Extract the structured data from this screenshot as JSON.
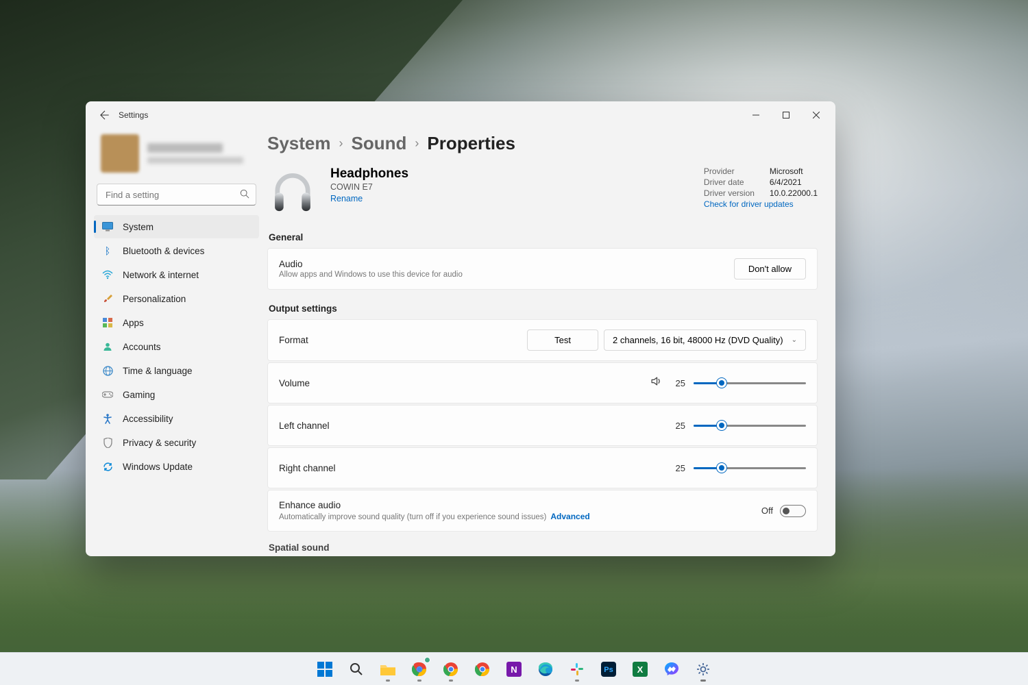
{
  "window": {
    "back_tooltip": "Back",
    "title": "Settings"
  },
  "search": {
    "placeholder": "Find a setting"
  },
  "sidebar": {
    "items": [
      {
        "label": "System",
        "icon": "display"
      },
      {
        "label": "Bluetooth & devices",
        "icon": "bluetooth"
      },
      {
        "label": "Network & internet",
        "icon": "wifi"
      },
      {
        "label": "Personalization",
        "icon": "brush"
      },
      {
        "label": "Apps",
        "icon": "apps"
      },
      {
        "label": "Accounts",
        "icon": "person"
      },
      {
        "label": "Time & language",
        "icon": "globe"
      },
      {
        "label": "Gaming",
        "icon": "gaming"
      },
      {
        "label": "Accessibility",
        "icon": "accessibility"
      },
      {
        "label": "Privacy & security",
        "icon": "shield"
      },
      {
        "label": "Windows Update",
        "icon": "update"
      }
    ]
  },
  "breadcrumb": {
    "a": "System",
    "b": "Sound",
    "c": "Properties"
  },
  "device": {
    "name": "Headphones",
    "model": "COWIN E7",
    "rename": "Rename"
  },
  "driver": {
    "provider_label": "Provider",
    "provider": "Microsoft",
    "date_label": "Driver date",
    "date": "6/4/2021",
    "version_label": "Driver version",
    "version": "10.0.22000.1",
    "check": "Check for driver updates"
  },
  "general": {
    "heading": "General",
    "audio_title": "Audio",
    "audio_desc": "Allow apps and Windows to use this device for audio",
    "dont_allow": "Don't allow"
  },
  "output": {
    "heading": "Output settings",
    "format_label": "Format",
    "test": "Test",
    "format_value": "2 channels, 16 bit, 48000 Hz (DVD Quality)",
    "volume_label": "Volume",
    "volume_value": "25",
    "left_label": "Left channel",
    "left_value": "25",
    "right_label": "Right channel",
    "right_value": "25",
    "enhance_title": "Enhance audio",
    "enhance_desc": "Automatically improve sound quality (turn off if you experience sound issues)",
    "advanced": "Advanced",
    "enhance_state": "Off"
  },
  "spatial": {
    "heading": "Spatial sound"
  }
}
